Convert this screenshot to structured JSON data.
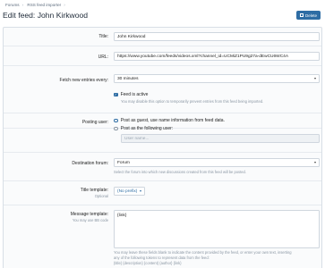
{
  "breadcrumb": [
    "Forums",
    "RSS feed importer"
  ],
  "page_title": "Edit feed: John Kirkwood",
  "delete_label": "Delete",
  "fields": {
    "title": {
      "label": "Title:",
      "value": "John Kirkwood"
    },
    "url": {
      "label": "URL:",
      "value": "https://www.youtube.com/feeds/videos.xml?channel_id=UCMiZ1PU9g27a-dEwCU6WC4A"
    },
    "frequency": {
      "label": "Fetch new entries every:",
      "value": "30 minutes"
    },
    "active": {
      "label": "Feed is active",
      "hint": "You may disable this option to temporarily prevent entries from this feed being imported.",
      "checked": true
    },
    "posting_user": {
      "label": "Posting user:",
      "option_guest": "Post as guest, use name information from feed data.",
      "option_user": "Post as the following user:",
      "username_placeholder": "User name..."
    },
    "destination": {
      "label": "Destination forum:",
      "value": "Forum",
      "hint": "Select the forum into which new discussions created from this feed will be posted."
    },
    "title_template": {
      "label": "Title template:",
      "sublabel": "Optional",
      "value": "(No prefix)"
    },
    "message_template": {
      "label": "Message template:",
      "sublabel": "You may use BB code",
      "value": "{link}",
      "hint1": "You may leave these fields blank to indicate the content provided by the feed, or enter your own text, inserting",
      "hint2": "any of the following tokens to represent data from the feed:",
      "hint3": "{title} {description} {content} {author} {link}"
    }
  }
}
